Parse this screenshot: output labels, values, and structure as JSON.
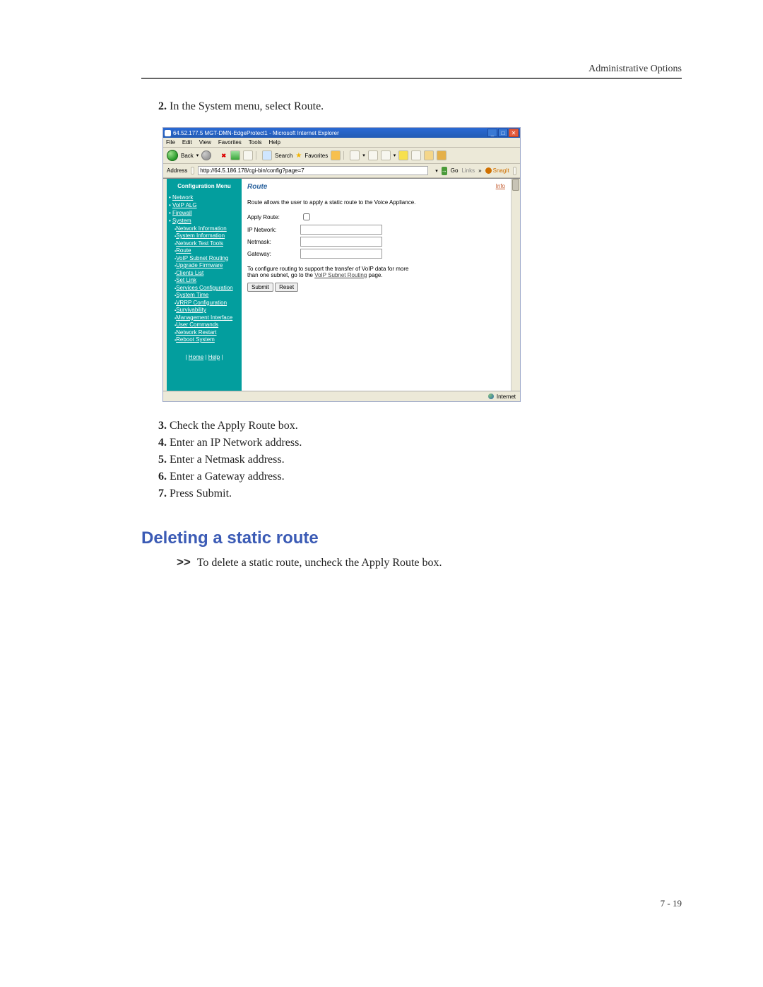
{
  "header": {
    "section_title": "Administrative Options"
  },
  "steps_before": {
    "start": 2,
    "items": [
      "In the System menu, select Route."
    ]
  },
  "steps_after": {
    "start": 3,
    "items": [
      "Check the Apply Route box.",
      "Enter an IP Network address.",
      "Enter a Netmask address.",
      "Enter a Gateway address.",
      "Press Submit."
    ]
  },
  "subheading": "Deleting a static route",
  "delete_note": {
    "arrow": ">>",
    "text": "To delete a static route, uncheck the Apply Route box."
  },
  "footer": {
    "page_no": "7 - 19"
  },
  "browser": {
    "title": "64.52.177.5 MGT-DMN-EdgeProtect1 - Microsoft Internet Explorer",
    "menu": [
      "File",
      "Edit",
      "View",
      "Favorites",
      "Tools",
      "Help"
    ],
    "toolbar": {
      "back": "Back",
      "search": "Search",
      "favorites": "Favorites"
    },
    "address": {
      "label": "Address",
      "url": "http://64.5.186.178/cgi-bin/config?page=7",
      "go": "Go",
      "links": "Links",
      "snagit": "SnagIt"
    },
    "status": {
      "zone": "Internet"
    }
  },
  "sidebar": {
    "title": "Configuration Menu",
    "top": [
      "Network",
      "VoIP ALG",
      "Firewall",
      "System"
    ],
    "system_children": [
      "Network Information",
      "System Information",
      "Network Test Tools",
      "Route",
      "VoIP Subnet Routing",
      "Upgrade Firmware",
      "Clients List",
      "Set Link",
      "Services Configuration",
      "System Time",
      "VRRP Configuration",
      "Survivability",
      "Management Interface",
      "User Commands",
      "Network Restart",
      "Reboot System"
    ],
    "bottom": {
      "home": "Home",
      "help": "Help"
    }
  },
  "route_panel": {
    "title": "Route",
    "info": "Info",
    "descr": "Route allows the user to apply a static route to the Voice Appliance.",
    "form": {
      "apply_route": "Apply Route:",
      "ip_network": "IP Network:",
      "netmask": "Netmask:",
      "gateway": "Gateway:"
    },
    "note_pre": "To configure routing to support the transfer of VoIP data for more than one subnet, go to the ",
    "note_link": "VoIP Subnet Routing",
    "note_post": " page.",
    "submit": "Submit",
    "reset": "Reset"
  }
}
